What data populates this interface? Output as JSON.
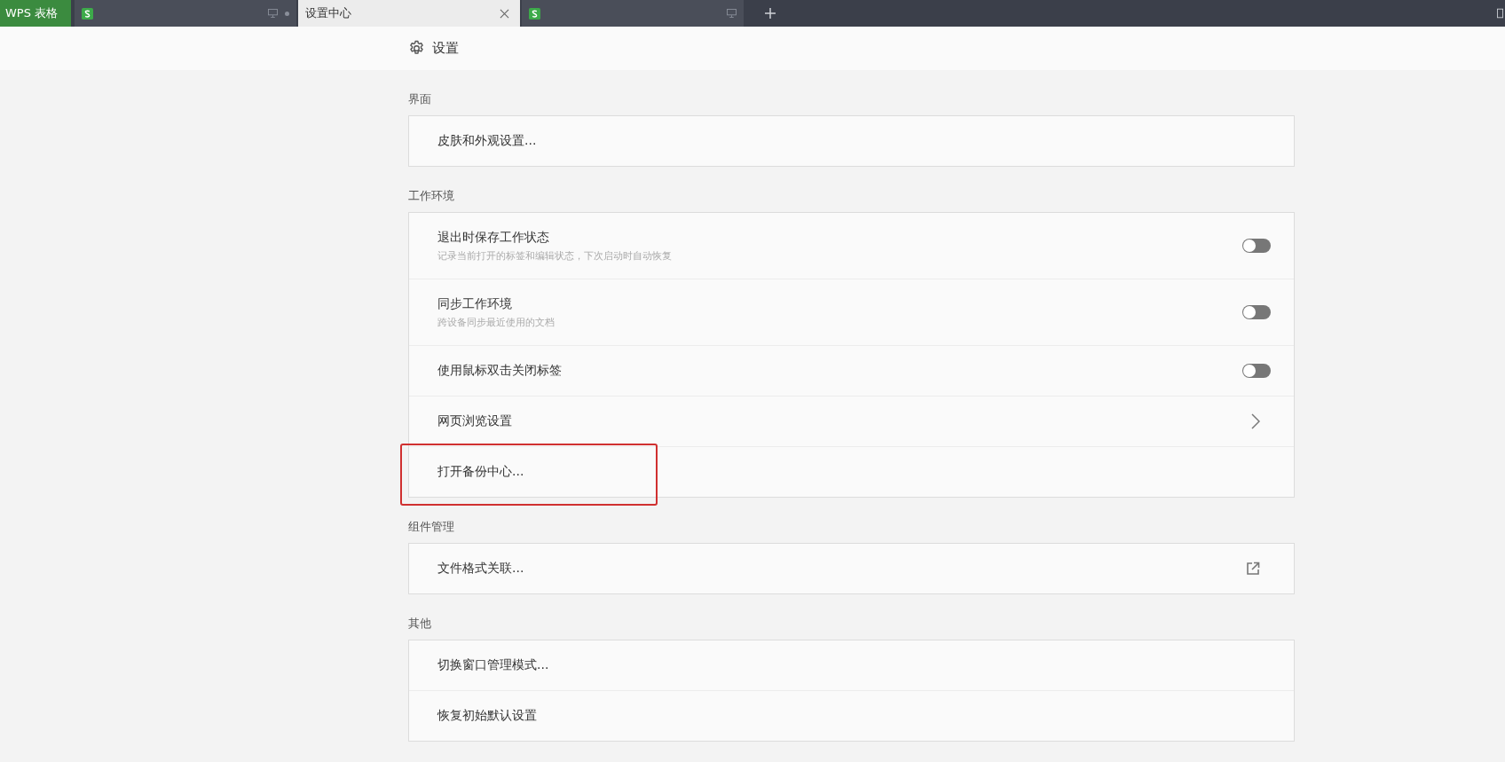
{
  "tabs": [
    {
      "kind": "app",
      "label": "WPS 表格",
      "selected": false
    },
    {
      "kind": "doc",
      "selected": false,
      "dot": true
    },
    {
      "kind": "page",
      "label": "设置中心",
      "selected": true
    },
    {
      "kind": "doc",
      "selected": false
    }
  ],
  "header": {
    "title": "设置"
  },
  "sections": [
    {
      "label": "界面",
      "rows": [
        {
          "kind": "link",
          "title": "皮肤和外观设置...",
          "highlighted": false
        }
      ]
    },
    {
      "label": "工作环境",
      "rows": [
        {
          "kind": "toggle",
          "title": "退出时保存工作状态",
          "subtitle": "记录当前打开的标签和编辑状态，下次启动时自动恢复",
          "on": false,
          "highlighted": false
        },
        {
          "kind": "toggle",
          "title": "同步工作环境",
          "subtitle": "跨设备同步最近使用的文档",
          "on": false,
          "highlighted": false
        },
        {
          "kind": "toggle",
          "title": "使用鼠标双击关闭标签",
          "on": false,
          "highlighted": false
        },
        {
          "kind": "chevron",
          "title": "网页浏览设置",
          "highlighted": false
        },
        {
          "kind": "link",
          "title": "打开备份中心...",
          "highlighted": true
        }
      ]
    },
    {
      "label": "组件管理",
      "rows": [
        {
          "kind": "external",
          "title": "文件格式关联...",
          "highlighted": false
        }
      ]
    },
    {
      "label": "其他",
      "rows": [
        {
          "kind": "link",
          "title": "切换窗口管理模式...",
          "highlighted": false
        },
        {
          "kind": "link",
          "title": "恢复初始默认设置",
          "highlighted": false
        }
      ]
    }
  ]
}
